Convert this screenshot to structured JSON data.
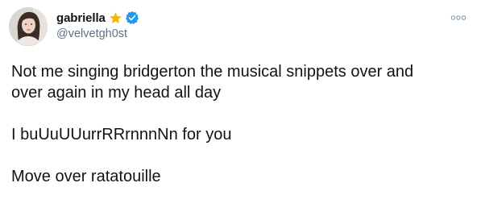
{
  "user": {
    "display_name": "gabriella",
    "handle": "@velvetgh0st"
  },
  "icons": {
    "star": "star-icon",
    "verified": "verified-badge-icon",
    "more": "more-options-icon"
  },
  "colors": {
    "star": "#f7b500",
    "verified": "#1d9bf0",
    "handle": "#5b7083",
    "text": "#0f1419"
  },
  "tweet": {
    "lines": [
      "Not me singing bridgerton the musical snippets over and",
      "over again in my head all day",
      "I buUuUUurrRRrnnnNn for you",
      "Move over ratatouille"
    ]
  }
}
